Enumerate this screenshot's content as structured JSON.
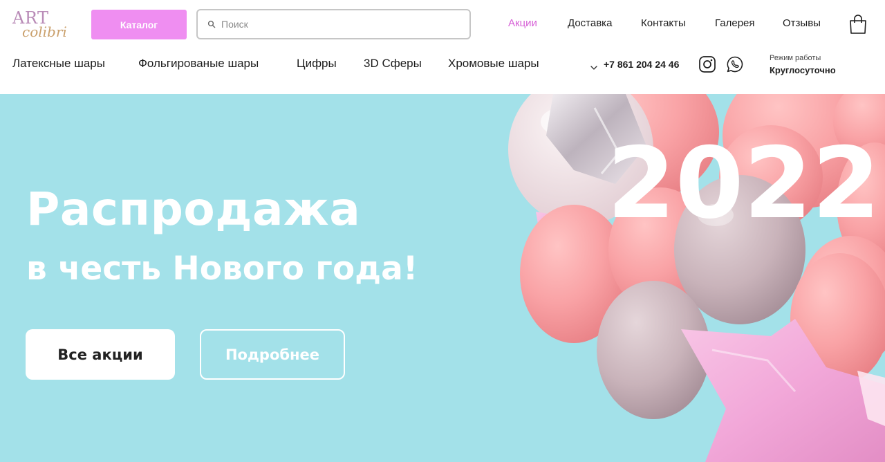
{
  "logo": {
    "line1": "ART",
    "line2": "colibri"
  },
  "header": {
    "catalog_label": "Каталог",
    "search": {
      "placeholder": "Поиск",
      "value": ""
    },
    "nav": [
      {
        "label": "Акции",
        "active": true
      },
      {
        "label": "Доставка",
        "active": false
      },
      {
        "label": "Контакты",
        "active": false
      },
      {
        "label": "Галерея",
        "active": false
      },
      {
        "label": "Отзывы",
        "active": false
      }
    ],
    "categories": [
      {
        "label": "Латексные шары"
      },
      {
        "label": "Фольгированые шары"
      },
      {
        "label": "Цифры"
      },
      {
        "label": "3D Сферы"
      },
      {
        "label": "Хромовые шары"
      }
    ],
    "phone": "+7 861 204 24 46",
    "hours_label": "Режим работы",
    "hours_value": "Круглосуточно"
  },
  "hero": {
    "title": "Распродажа",
    "subtitle": "в честь Нового года!",
    "year": "2022",
    "button_primary": "Все акции",
    "button_secondary": "Подробнее"
  },
  "colors": {
    "accent": "#ef8ef1",
    "active_nav": "#d65fd6",
    "hero_bg": "#a3e1e9",
    "balloon_pink": "#f9a2a5",
    "balloon_grey": "#c9b3ba",
    "balloon_star": "#f5b3df"
  },
  "icons": {
    "search": "search-icon",
    "cart": "shopping-bag-icon",
    "instagram": "instagram-icon",
    "whatsapp": "whatsapp-icon",
    "phone_dropdown": "chevron-down-icon"
  }
}
